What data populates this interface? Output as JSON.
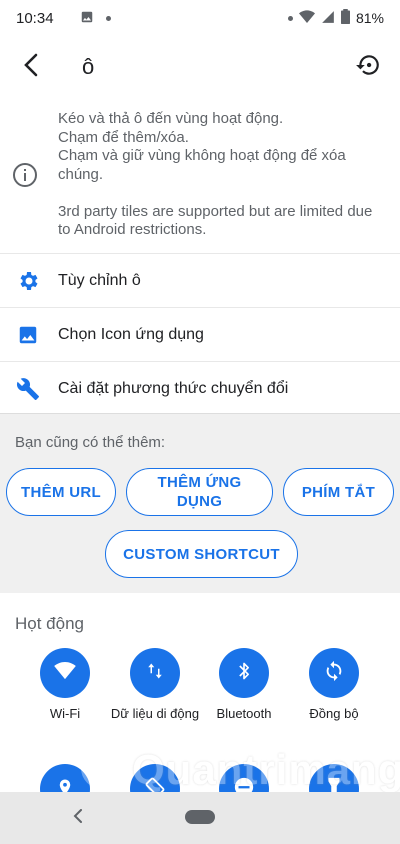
{
  "status_bar": {
    "time": "10:34",
    "battery": "81%",
    "icons": [
      "image-icon",
      "dot-icon",
      "dot-icon",
      "wifi-icon",
      "signal-icon",
      "battery-icon"
    ]
  },
  "app_bar": {
    "title": "ô",
    "back_icon": "arrow-back-icon",
    "reset_icon": "restore-icon"
  },
  "info": {
    "icon": "info-icon",
    "line1": "Kéo và thả ô đến vùng hoạt động.",
    "line2": "Chạm để thêm/xóa.",
    "line3": "Chạm và giữ vùng không hoạt động để xóa chúng.",
    "line4": "3rd party tiles are supported but are limited due to Android restrictions."
  },
  "menu": [
    {
      "label": "Tùy chỉnh ô",
      "icon": "gear-icon"
    },
    {
      "label": "Chọn Icon ứng dụng",
      "icon": "image-icon"
    },
    {
      "label": "Cài đặt phương thức chuyển đổi",
      "icon": "wrench-icon"
    }
  ],
  "add_section": {
    "heading": "Bạn cũng có thể thêm:",
    "buttons": {
      "add_url": "THÊM URL",
      "add_app": "THÊM ỨNG DỤNG",
      "shortcut": "PHÍM TẮT",
      "custom_shortcut": "CUSTOM SHORTCUT"
    }
  },
  "active_section": {
    "heading": "Họt động",
    "tiles": [
      {
        "label": "Wi-Fi",
        "icon": "wifi-icon"
      },
      {
        "label": "Dữ liệu di động",
        "icon": "mobile-data-icon"
      },
      {
        "label": "Bluetooth",
        "icon": "bluetooth-icon"
      },
      {
        "label": "Đồng bộ",
        "icon": "sync-icon"
      }
    ],
    "second_row_icons": [
      "location-icon",
      "rotate-icon",
      "do-not-disturb-icon",
      "flashlight-icon"
    ]
  },
  "watermark": {
    "text": "Quantrimang"
  },
  "colors": {
    "accent": "#1a73e8",
    "secondary_text": "#5f6368",
    "section_bg": "#f0f0f0",
    "nav_bg": "#e8e8e8"
  }
}
